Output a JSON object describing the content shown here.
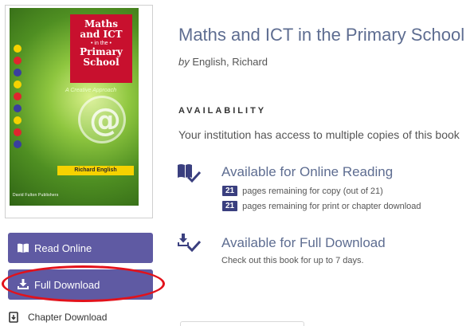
{
  "book": {
    "title": "Maths and ICT in the Primary School",
    "by_label": "by",
    "author": "English, Richard"
  },
  "cover": {
    "title_line1": "Maths",
    "title_line2": "and ICT",
    "title_line3": "• in the •",
    "title_line4": "Primary",
    "title_line5": "School",
    "subtitle": "A Creative Approach",
    "author": "Richard English",
    "publisher": "David Fulton Publishers",
    "colors": {
      "background": "#8ec63f",
      "title_box": "#c8102e",
      "author_bar": "#f6d200"
    },
    "dot_colors": [
      "#f6d200",
      "#e0262e",
      "#3a3f9f",
      "#f6d200",
      "#e0262e",
      "#3a3f9f",
      "#f6d200",
      "#e0262e",
      "#3a3f9f"
    ]
  },
  "actions": {
    "read_online": {
      "label": "Read Online",
      "icon": "open-book-icon"
    },
    "full_download": {
      "label": "Full Download",
      "icon": "download-icon"
    },
    "chapter_download": {
      "label": "Chapter Download",
      "icon": "chapter-download-icon"
    }
  },
  "availability": {
    "heading": "AVAILABILITY",
    "access_text": "Your institution has access to multiple copies of this book",
    "online_reading": {
      "title": "Available for Online Reading",
      "icon": "book-check-icon",
      "copy_count": "21",
      "copy_text": "pages remaining for copy (out of 21)",
      "print_count": "21",
      "print_text": "pages remaining for print or chapter download"
    },
    "full_download": {
      "title": "Available for Full Download",
      "icon": "download-check-icon",
      "note": "Check out this book for up to 7 days."
    }
  },
  "colors": {
    "accent": "#5f5aa3",
    "title_text": "#5e6d91",
    "badge": "#3a3f7f",
    "highlight": "#e2121b"
  }
}
